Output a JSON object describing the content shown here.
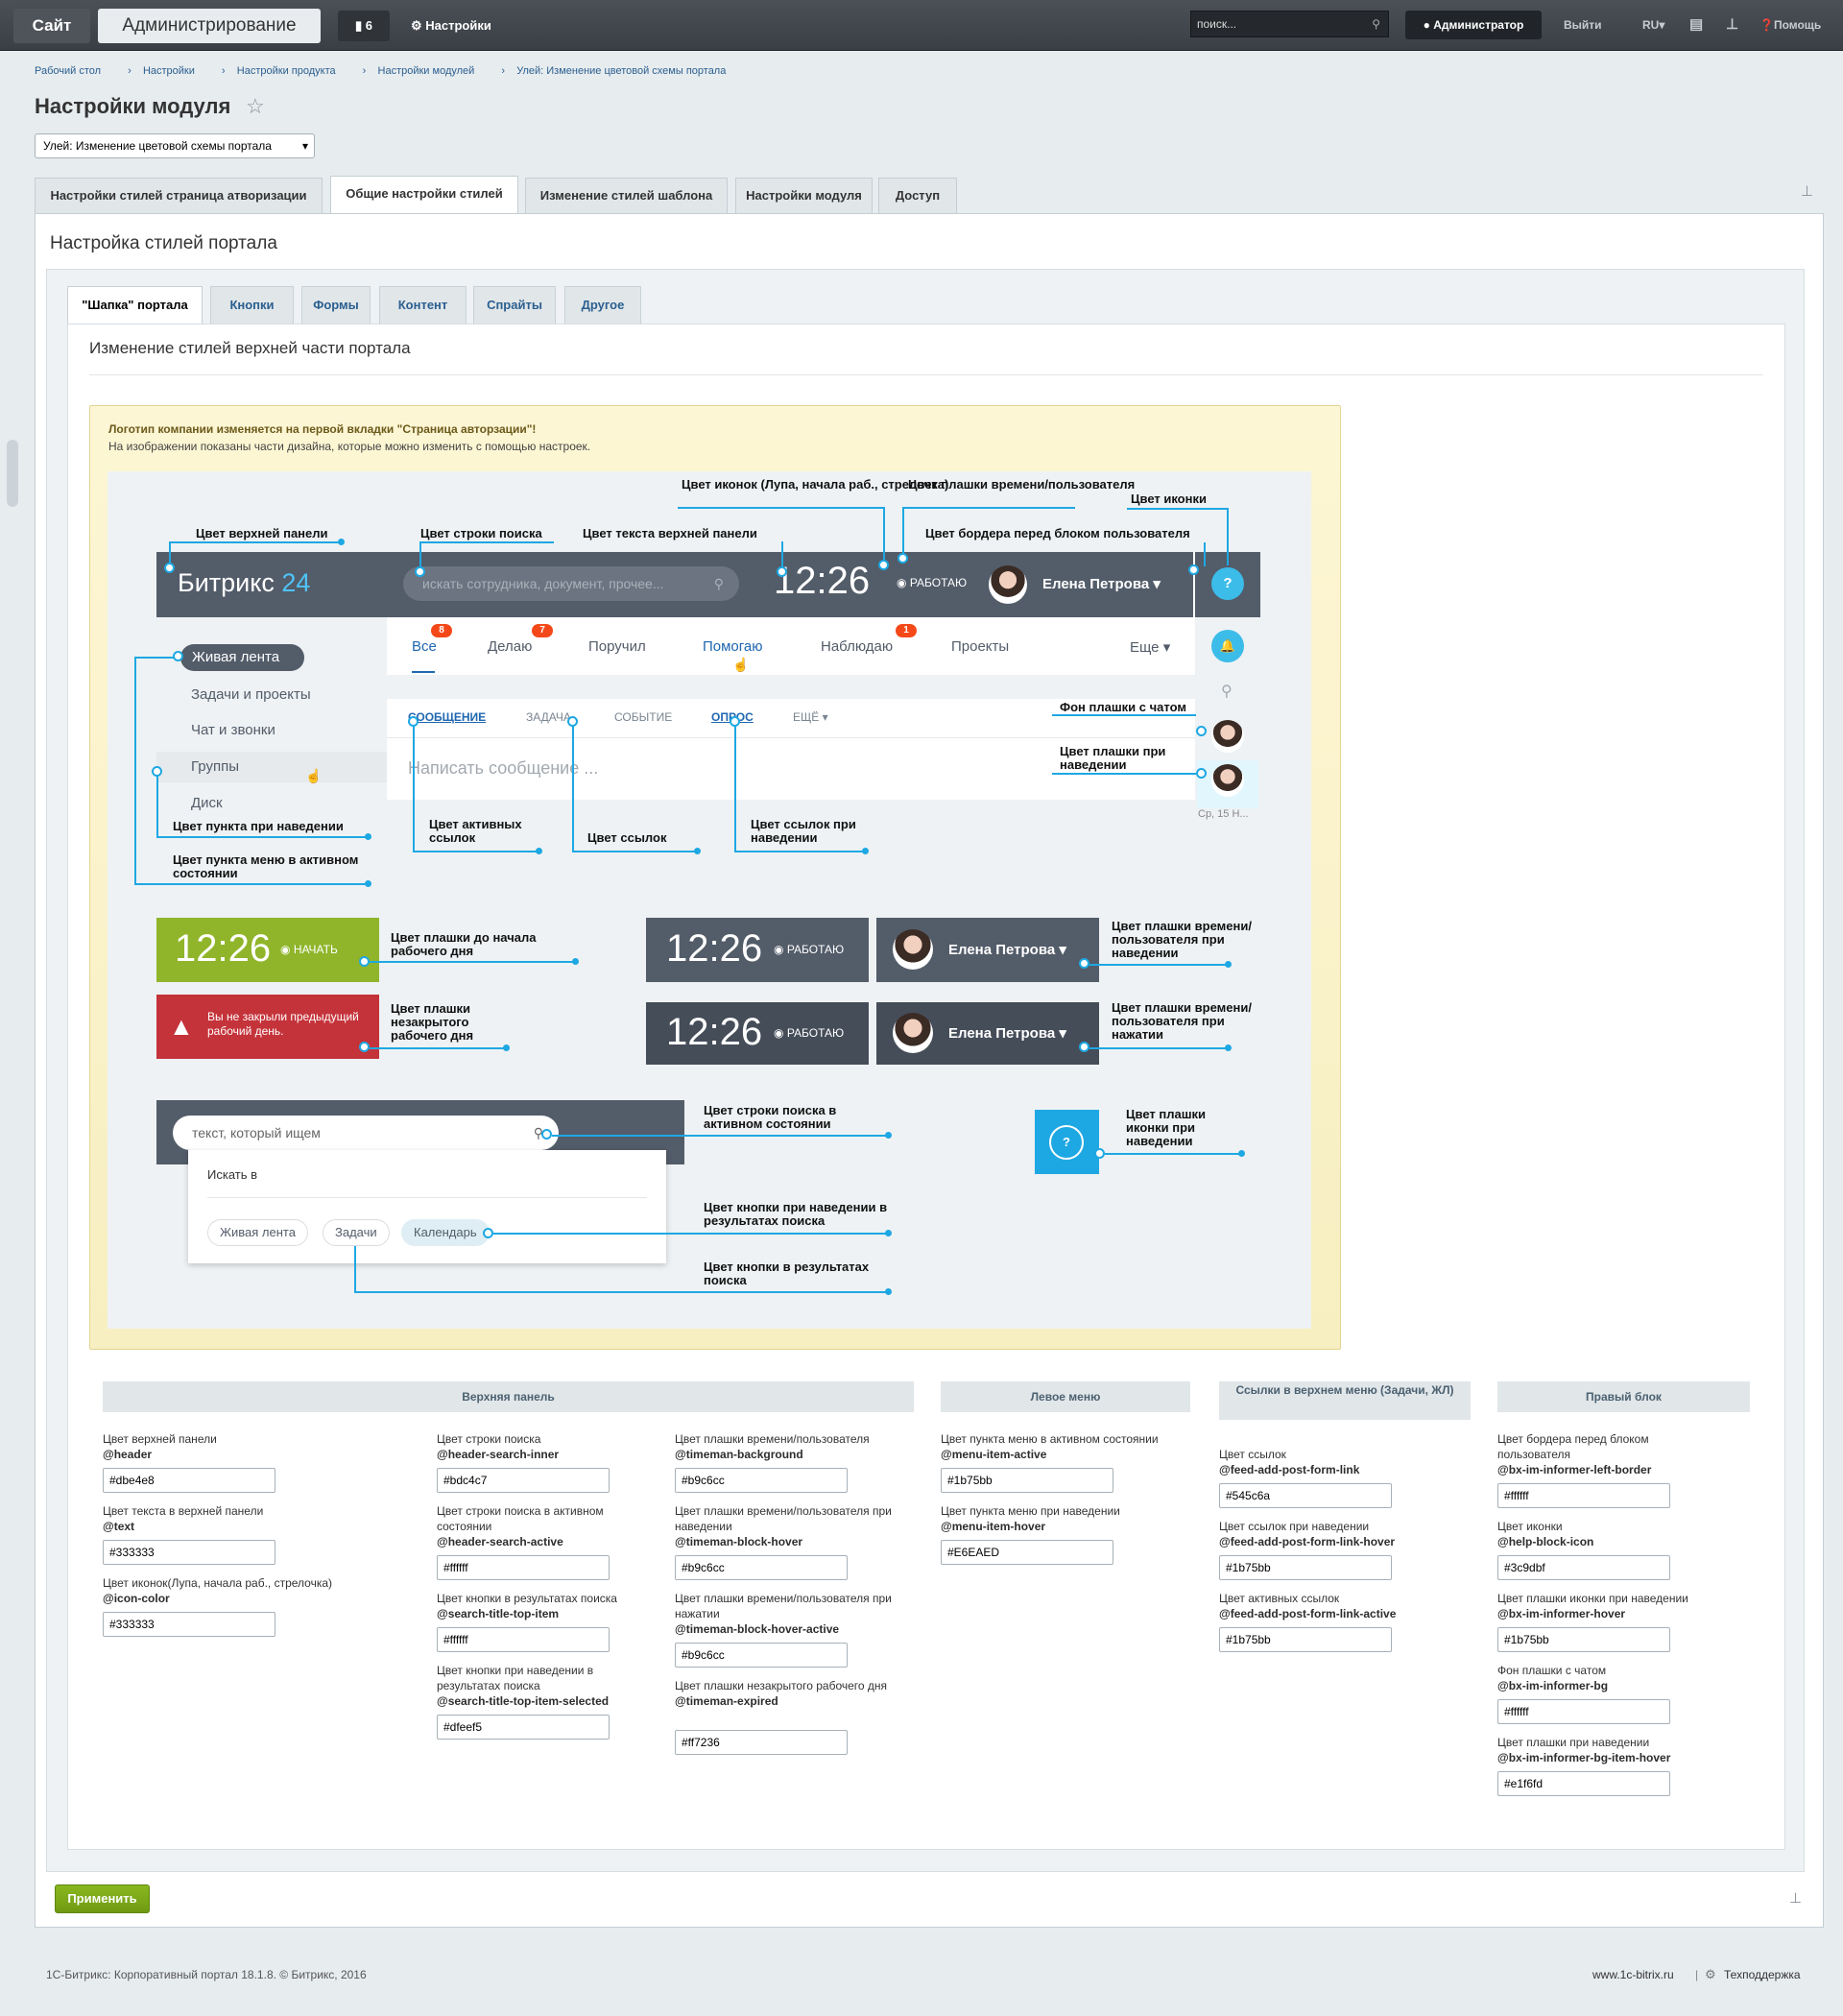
{
  "topbar": {
    "site": "Сайт",
    "admin": "Администрирование",
    "notifications": "6",
    "settings": "Настройки",
    "search_placeholder": "поиск...",
    "user": "Администратор",
    "logout": "Выйти",
    "lang": "RU",
    "help": "Помощь"
  },
  "breadcrumbs": [
    "Рабочий стол",
    "Настройки",
    "Настройки продукта",
    "Настройки модулей",
    "Улей: Изменение цветовой схемы портала"
  ],
  "page_title": "Настройки модуля",
  "module_select": "Улей: Изменение цветовой схемы портала",
  "tabs": [
    "Настройки стилей страница атворизации",
    "Общие настройки стилей",
    "Изменение стилей шаблона",
    "Настройки модуля",
    "Доступ"
  ],
  "section_title": "Настройка стилей портала",
  "subtabs": [
    "\"Шапка\" портала",
    "Кнопки",
    "Формы",
    "Контент",
    "Спрайты",
    "Другое"
  ],
  "content_title": "Изменение стилей верхней части портала",
  "notice": {
    "line1": "Логотип компании изменяется на первой вкладки \"Страница авторзации\"!",
    "line2": "На изображении показаны части дизайна, которые можно изменить с помощью настроек."
  },
  "mock": {
    "logo": "Битрикс",
    "logo_num": "24",
    "search": "искать сотрудника, документ, прочее...",
    "time": "12:26",
    "work": "РАБОТАЮ",
    "user": "Елена Петрова",
    "feed_tabs": [
      "Все",
      "Делаю",
      "Поручил",
      "Помогаю",
      "Наблюдаю",
      "Проекты",
      "Еще"
    ],
    "badges": [
      "8",
      "7",
      "1"
    ],
    "post_tabs": [
      "СООБЩЕНИЕ",
      "ЗАДАЧА",
      "СОБЫТИЕ",
      "ОПРОС",
      "ЕЩЁ"
    ],
    "post_input": "Написать сообщение ...",
    "menu": [
      "Живая лента",
      "Задачи и проекты",
      "Чат и звонки",
      "Группы",
      "Диск"
    ],
    "right_date": "Ср, 15 Н...",
    "start": "НАЧАТЬ",
    "expired": "Вы не закрыли предыдущий рабочий день.",
    "search_text": "текст, который ищем",
    "search_in": "Искать в",
    "chips": [
      "Живая лента",
      "Задачи",
      "Календарь"
    ]
  },
  "labels": {
    "icon_color": "Цвет иконок (Лупа, начала раб., стрелочка)",
    "timeman_plate": "Цвет плашки времени/пользователя",
    "icon": "Цвет иконки",
    "header": "Цвет верхней панели",
    "search_row": "Цвет строки поиска",
    "header_text": "Цвет текста верхней панели",
    "border_user": "Цвет бордера перед блоком пользователя",
    "chat_bg": "Фон плашки с чатом",
    "plate_hover": "Цвет плашки при наведении",
    "item_hover": "Цвет пункта при наведении",
    "menu_active": "Цвет пункта меню в активном состоянии",
    "active_links": "Цвет активных ссылок",
    "links": "Цвет ссылок",
    "links_hover": "Цвет ссылок при наведении",
    "before_day": "Цвет плашки до начала рабочего дня",
    "unclosed_day": "Цвет плашки незакрытого рабочего дня",
    "time_hover": "Цвет плашки времени/пользователя при наведении",
    "time_press": "Цвет плашки времени/пользователя при нажатии",
    "search_active": "Цвет строки поиска в активном состоянии",
    "icon_hover": "Цвет плашки иконки при наведении",
    "btn_hover": "Цвет кнопки при наведении в результатах поиска",
    "btn": "Цвет кнопки в результатах поиска"
  },
  "sections": [
    "Верхняя панель",
    "Левое меню",
    "Ссылки в верхнем меню (Задачи, ЖЛ)",
    "Правый блок"
  ],
  "fields": {
    "header": {
      "label": "Цвет верхней панели",
      "var": "@header",
      "value": "#dbe4e8"
    },
    "text": {
      "label": "Цвет текста в верхней панели",
      "var": "@text",
      "value": "#333333"
    },
    "icon_color": {
      "label": "Цвет иконок(Лупа, начала раб., стрелочка)",
      "var": "@icon-color",
      "value": "#333333"
    },
    "search_inner": {
      "label": "Цвет строки поиска",
      "var": "@header-search-inner",
      "value": "#bdc4c7"
    },
    "search_active": {
      "label": "Цвет строки поиска в активном состоянии",
      "var": "@header-search-active",
      "value": "#ffffff"
    },
    "search_item": {
      "label": "Цвет кнопки в результатах поиска",
      "var": "@search-title-top-item",
      "value": "#ffffff"
    },
    "search_item_sel": {
      "label": "Цвет кнопки при наведении в результатах поиска",
      "var": "@search-title-top-item-selected",
      "value": "#dfeef5"
    },
    "tm_bg": {
      "label": "Цвет плашки времени/пользователя",
      "var": "@timeman-background",
      "value": "#b9c6cc"
    },
    "tm_hover": {
      "label": "Цвет плашки времени/пользователя при наведении",
      "var": "@timeman-block-hover",
      "value": "#b9c6cc"
    },
    "tm_active": {
      "label": "Цвет плашки времени/пользователя при нажатии",
      "var": "@timeman-block-hover-active",
      "value": "#b9c6cc"
    },
    "tm_expired": {
      "label": "Цвет плашки незакрытого рабочего дня",
      "var": "@timeman-expired",
      "value": "#ff7236"
    },
    "menu_active": {
      "label": "Цвет пункта меню в активном состоянии",
      "var": "@menu-item-active",
      "value": "#1b75bb"
    },
    "menu_hover": {
      "label": "Цвет пункта меню при наведении",
      "var": "@menu-item-hover",
      "value": "#E6EAED"
    },
    "link": {
      "label": "Цвет ссылок",
      "var": "@feed-add-post-form-link",
      "value": "#545c6a"
    },
    "link_hover": {
      "label": "Цвет ссылок при наведении",
      "var": "@feed-add-post-form-link-hover",
      "value": "#1b75bb"
    },
    "link_active": {
      "label": "Цвет активных ссылок",
      "var": "@feed-add-post-form-link-active",
      "value": "#1b75bb"
    },
    "inf_border": {
      "label": "Цвет бордера перед блоком пользователя",
      "var": "@bx-im-informer-left-border",
      "value": "#ffffff"
    },
    "help_icon": {
      "label": "Цвет иконки",
      "var": "@help-block-icon",
      "value": "#3c9dbf"
    },
    "inf_hover": {
      "label": "Цвет плашки иконки при наведении",
      "var": "@bx-im-informer-hover",
      "value": "#1b75bb"
    },
    "inf_bg": {
      "label": "Фон плашки с чатом",
      "var": "@bx-im-informer-bg",
      "value": "#ffffff"
    },
    "inf_item_hover": {
      "label": "Цвет плашки при наведении",
      "var": "@bx-im-informer-bg-item-hover",
      "value": "#e1f6fd"
    }
  },
  "apply": "Применить",
  "footer": {
    "left": "1С-Битрикс: Корпоративный портал 18.1.8. © Битрикс, 2016",
    "site": "www.1c-bitrix.ru",
    "support": "Техподдержка"
  }
}
